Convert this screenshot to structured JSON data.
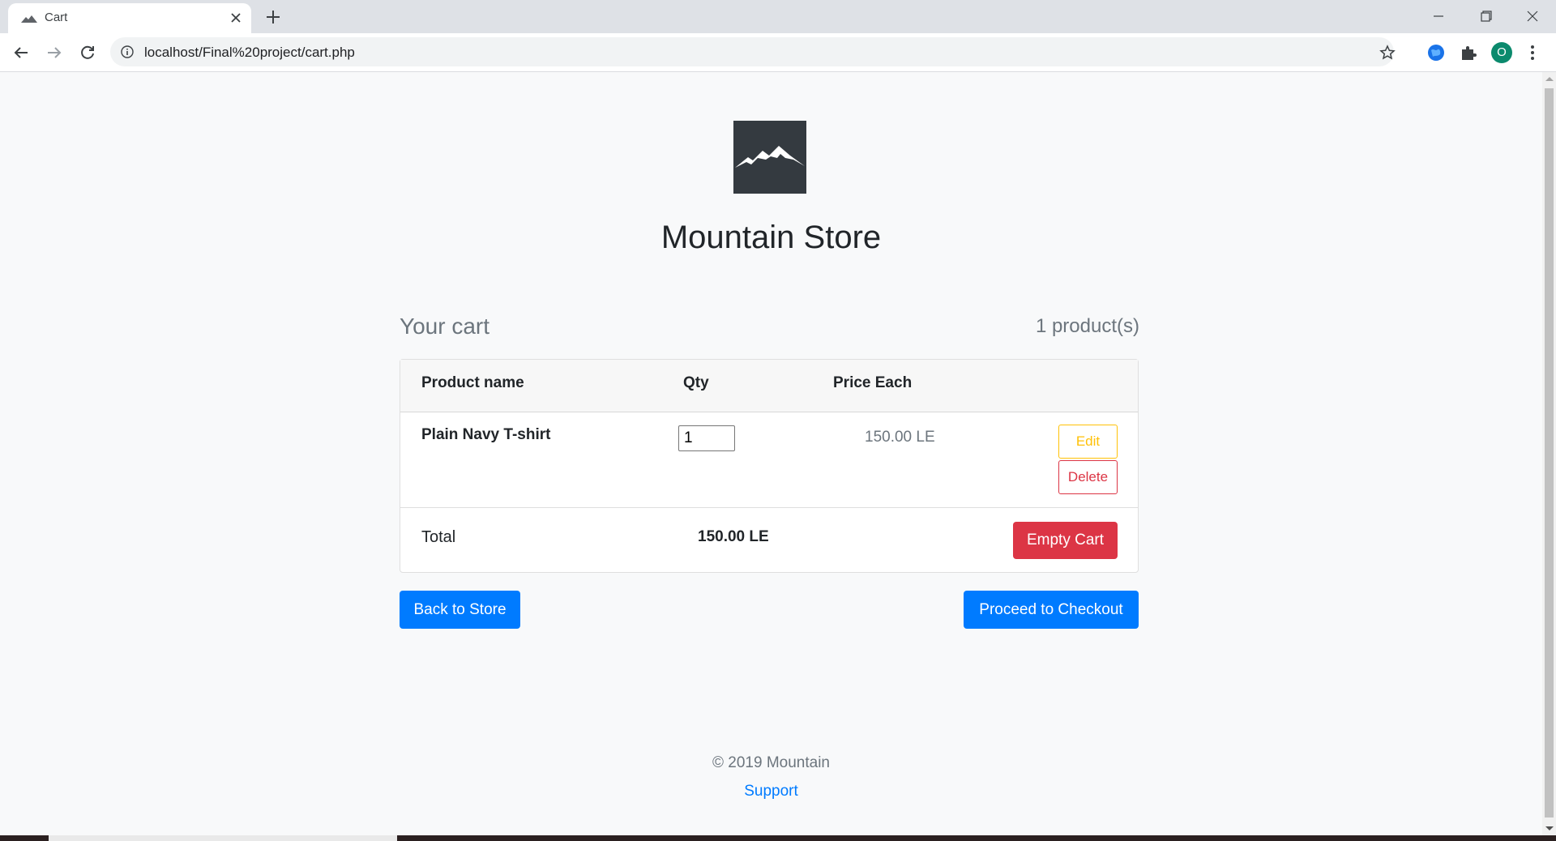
{
  "browser": {
    "tab_title": "Cart",
    "url": "localhost/Final%20project/cart.php",
    "profile_initial": "O",
    "icons": {
      "tab_favicon": "mountain-icon",
      "close": "close-icon",
      "new_tab": "plus-icon",
      "back": "back-arrow-icon",
      "forward": "forward-arrow-icon",
      "reload": "reload-icon",
      "info": "info-icon",
      "bookmark": "star-icon",
      "extension": "globe-icon",
      "extensions": "puzzle-icon",
      "menu": "kebab-menu-icon"
    }
  },
  "store": {
    "name": "Mountain Store",
    "logo_icon": "mountain-icon",
    "logo_bg": "#343a40"
  },
  "cart": {
    "heading": "Your cart",
    "count_text": "1 product(s)",
    "columns": [
      "Product name",
      "Qty",
      "Price Each"
    ],
    "items": [
      {
        "name": "Plain Navy T-shirt",
        "qty": "1",
        "price": "150.00 LE",
        "edit_label": "Edit",
        "delete_label": "Delete"
      }
    ],
    "total_label": "Total",
    "total_value": "150.00 LE",
    "empty_label": "Empty Cart"
  },
  "actions": {
    "back_label": "Back to Store",
    "checkout_label": "Proceed to Checkout"
  },
  "footer": {
    "copyright": "© 2019 Mountain",
    "support": "Support"
  },
  "colors": {
    "primary": "#007bff",
    "danger": "#dc3545",
    "warning": "#ffc107",
    "muted": "#6c757d"
  }
}
